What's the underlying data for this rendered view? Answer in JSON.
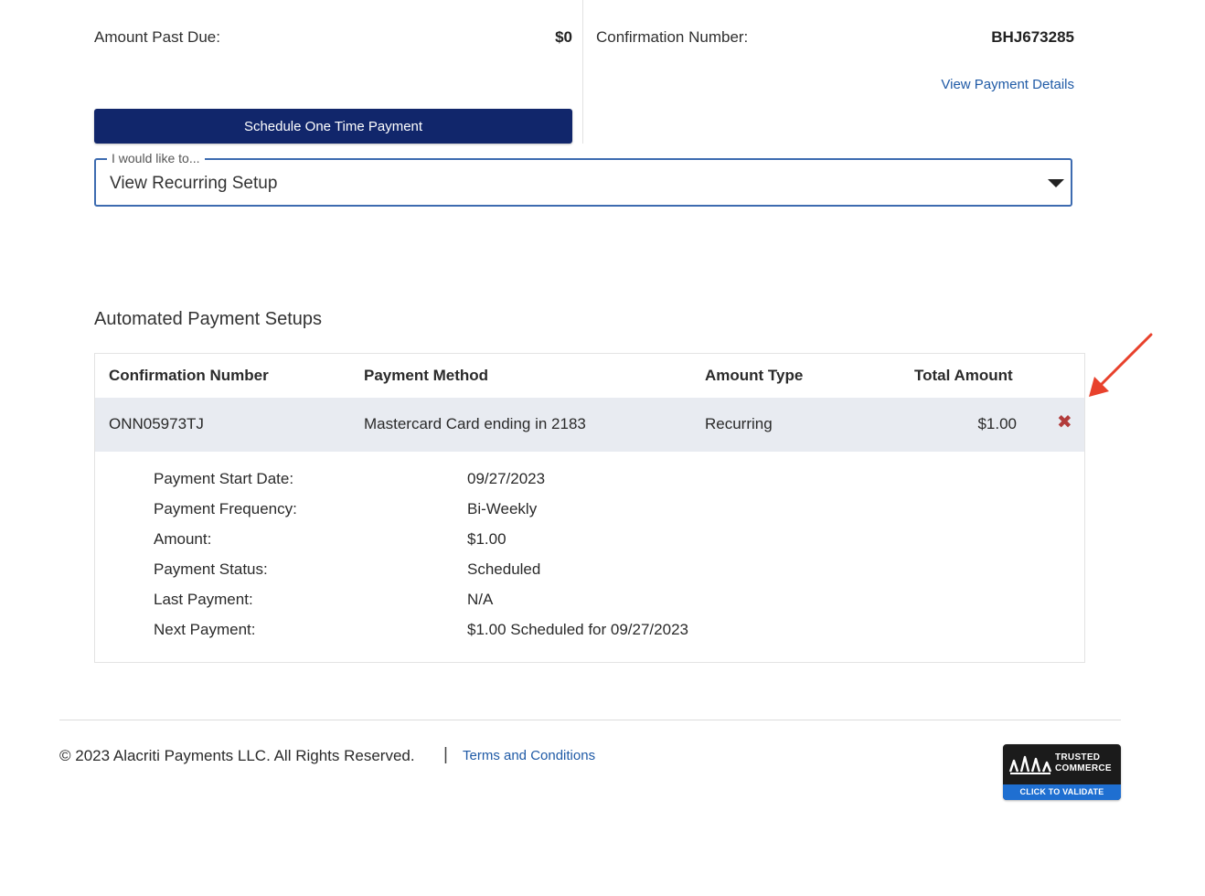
{
  "summary": {
    "past_due_label": "Amount Past Due:",
    "past_due_value": "$0",
    "confirmation_label": "Confirmation Number:",
    "confirmation_value": "BHJ673285",
    "view_details_link": "View Payment Details",
    "schedule_button": "Schedule One Time Payment"
  },
  "action_select": {
    "legend": "I would like to...",
    "value": "View Recurring Setup"
  },
  "automated": {
    "title": "Automated Payment Setups",
    "columns": [
      "Confirmation Number",
      "Payment Method",
      "Amount Type",
      "Total Amount"
    ],
    "row": {
      "confirmation": "ONN05973TJ",
      "method": "Mastercard Card ending in 2183",
      "amount_type": "Recurring",
      "total": "$1.00",
      "delete_icon": "✖"
    },
    "details": [
      {
        "label": "Payment Start Date:",
        "value": "09/27/2023"
      },
      {
        "label": "Payment Frequency:",
        "value": "Bi-Weekly"
      },
      {
        "label": "Amount:",
        "value": "$1.00"
      },
      {
        "label": "Payment Status:",
        "value": "Scheduled"
      },
      {
        "label": "Last Payment:",
        "value": "N/A"
      },
      {
        "label": "Next Payment:",
        "value": "$1.00 Scheduled for 09/27/2023"
      }
    ]
  },
  "footer": {
    "copyright": "© 2023 Alacriti Payments LLC. All Rights Reserved.",
    "separator": "|",
    "terms_link": "Terms and Conditions",
    "badge": {
      "line1": "TRUSTED",
      "line2": "COMMERCE",
      "validate": "CLICK TO VALIDATE"
    }
  },
  "colors": {
    "primary_button": "#11266b",
    "link": "#1f5aa6",
    "delete": "#b23b3b",
    "annotation_arrow": "#e8412c",
    "row_highlight": "#e8ebf1"
  },
  "icons": {
    "delete": "close-x-icon",
    "dropdown": "caret-down-icon",
    "annotation": "red-arrow-annotation-icon"
  }
}
